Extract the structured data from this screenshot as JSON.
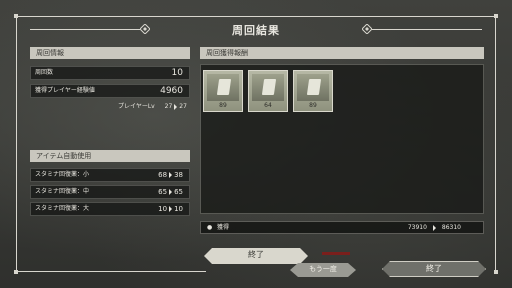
{
  "header": {
    "title": "周回結果"
  },
  "left": {
    "section_title": "周回情報",
    "rows": [
      {
        "label": "周回数",
        "value": "10"
      },
      {
        "label": "獲得プレイヤー経験値",
        "value": "4960"
      }
    ],
    "player_lv": {
      "label": "プレイヤーLv",
      "from": "27",
      "to": "27"
    },
    "item_section_title": "アイテム自動使用",
    "items": [
      {
        "label": "スタミナ回復薬：小",
        "from": "68",
        "to": "38"
      },
      {
        "label": "スタミナ回復薬：中",
        "from": "65",
        "to": "65"
      },
      {
        "label": "スタミナ回復薬：大",
        "from": "10",
        "to": "10"
      }
    ]
  },
  "right": {
    "section_title": "周回獲得報酬",
    "rewards": [
      {
        "icon": "memory-card-icon",
        "count": "89"
      },
      {
        "icon": "memory-card-icon",
        "count": "64"
      },
      {
        "icon": "memory-card-icon",
        "count": "89"
      }
    ],
    "total": {
      "label": "獲得",
      "from": "73910",
      "to": "86310"
    }
  },
  "buttons": {
    "main": "終了",
    "once_more": "もう一度",
    "end": "終了"
  }
}
